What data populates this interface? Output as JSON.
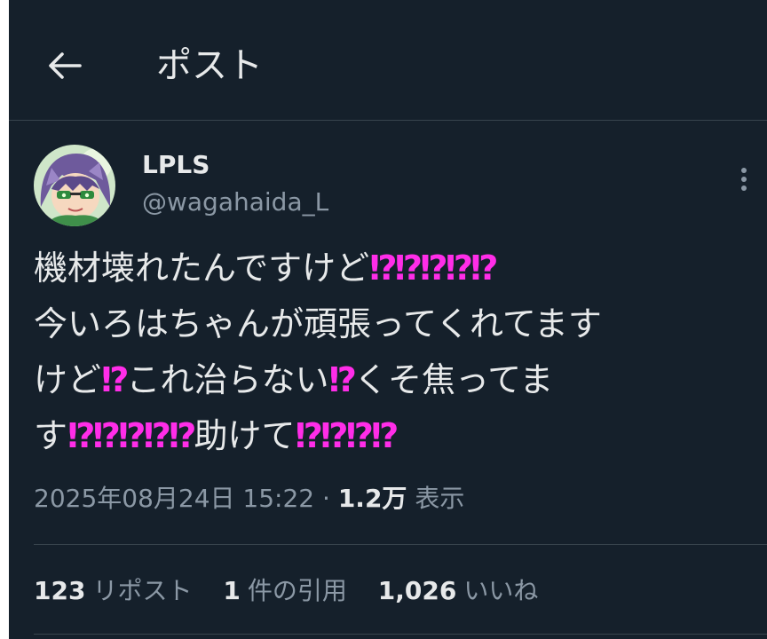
{
  "header": {
    "back_icon": "arrow-left-icon",
    "title": "ポスト"
  },
  "author": {
    "display_name": "LPLS",
    "handle": "@wagahaida_L",
    "avatar_icon": "anime-character-avatar"
  },
  "more_icon": "vertical-ellipsis-icon",
  "tweet": {
    "lines": [
      [
        {
          "text": "機材壊れたんですけど",
          "em": false
        },
        {
          "text": "⁉⁉⁉⁉⁉",
          "em": true
        }
      ],
      [
        {
          "text": "今いろはちゃんが頑張ってくれてます",
          "em": false
        }
      ],
      [
        {
          "text": "けど",
          "em": false
        },
        {
          "text": "⁉",
          "em": true
        },
        {
          "text": "これ治らない",
          "em": false
        },
        {
          "text": "⁉",
          "em": true
        },
        {
          "text": "くそ焦ってま",
          "em": false
        }
      ],
      [
        {
          "text": "す",
          "em": false
        },
        {
          "text": "⁉⁉⁉⁉⁉",
          "em": true
        },
        {
          "text": "助けて",
          "em": false
        },
        {
          "text": "⁉⁉⁉⁉",
          "em": true
        }
      ]
    ]
  },
  "meta": {
    "timestamp": "2025年08月24日 15:22",
    "separator": "·",
    "views_count": "1.2万",
    "views_label": "表示"
  },
  "stats": [
    {
      "count": "123",
      "label": "リポスト"
    },
    {
      "count": "1",
      "label": "件の引用"
    },
    {
      "count": "1,026",
      "label": "いいね"
    }
  ],
  "colors": {
    "background": "#15202b",
    "text": "#e7e9ea",
    "secondary": "#8b98a5",
    "divider": "#38444d",
    "emoji_magenta": "#ff2de8"
  }
}
